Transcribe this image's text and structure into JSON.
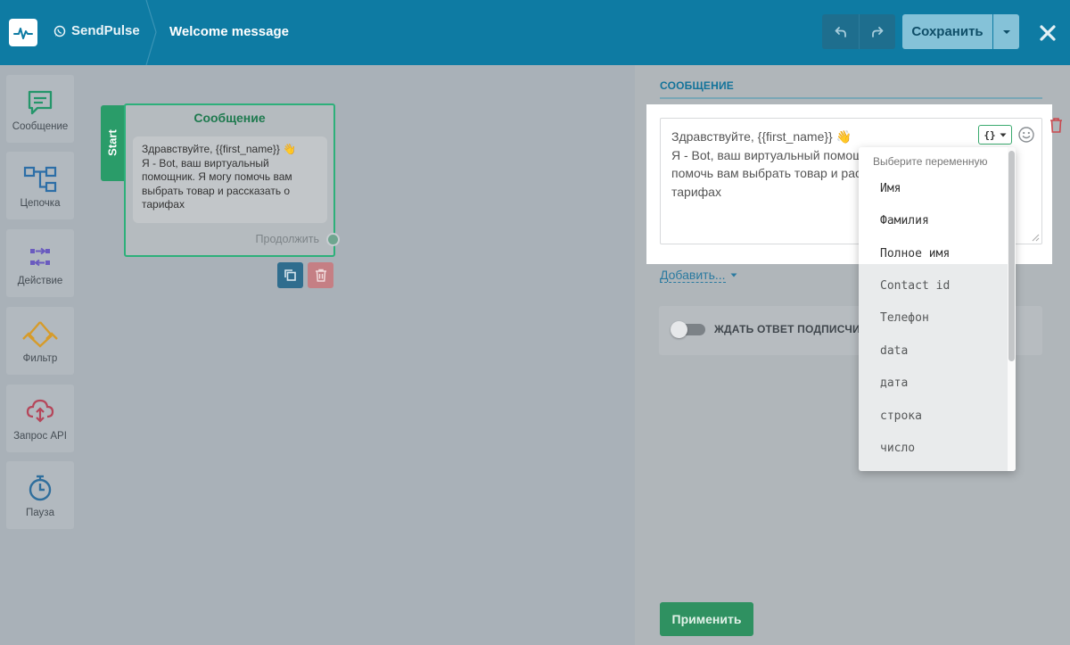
{
  "header": {
    "brand": "SendPulse",
    "title": "Welcome message",
    "save_label": "Сохранить"
  },
  "toolbar": {
    "items": [
      {
        "label": "Сообщение",
        "icon": "message-icon"
      },
      {
        "label": "Цепочка",
        "icon": "chain-icon"
      },
      {
        "label": "Действие",
        "icon": "action-icon"
      },
      {
        "label": "Фильтр",
        "icon": "filter-icon"
      },
      {
        "label": "Запрос API",
        "icon": "api-cloud-icon"
      },
      {
        "label": "Пауза",
        "icon": "timer-icon"
      }
    ]
  },
  "canvas": {
    "start_label": "Start",
    "node": {
      "title": "Сообщение",
      "text_line1": "Здравствуйте,  {{first_name}} 👋",
      "text_rest": "Я - Bot, ваш виртуальный помощник. Я могу помочь вам выбрать товар и рассказать о тарифах",
      "continue_label": "Продолжить"
    }
  },
  "panel": {
    "heading": "СООБЩЕНИЕ",
    "editor": {
      "line1": "Здравствуйте,  {{first_name}} 👋",
      "line2": "Я - Bot, ваш виртуальный помощник. Я могу",
      "line3": "помочь вам выбрать товар и рассказать о",
      "line4": "тарифах"
    },
    "add_link": "Добавить...",
    "wait_label": "ЖДАТЬ ОТВЕТ ПОДПИСЧИКА",
    "apply_label": "Применить"
  },
  "variables": {
    "header": "Выберите переменную",
    "items": [
      "Имя",
      "Фамилия",
      "Полное имя",
      "Contact id",
      "Телефон",
      "data",
      "дата",
      "строка",
      "число"
    ]
  },
  "colors": {
    "topbar": "#0e7ba3",
    "accent_green": "#2a9c69",
    "link_blue": "#2a7aa0"
  }
}
